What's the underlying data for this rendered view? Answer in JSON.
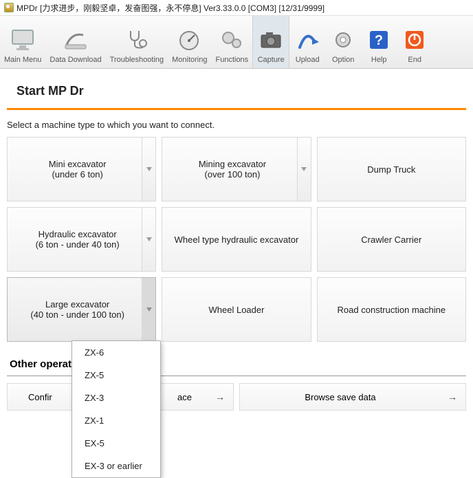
{
  "title": "MPDr [力求进步，刚毅坚卓，发奋图强，永不停息] Ver3.33.0.0 [COM3] [12/31/9999]",
  "toolbar": {
    "main": "Main Menu",
    "download": "Data Download",
    "trouble": "Troubleshooting",
    "monitor": "Monitoring",
    "functions": "Functions",
    "capture": "Capture",
    "upload": "Upload",
    "option": "Option",
    "help": "Help",
    "end": "End"
  },
  "page": {
    "heading": "Start MP Dr",
    "instruction": "Select a machine type to which you want to connect."
  },
  "machines": {
    "r1c1a": "Mini excavator",
    "r1c1b": "(under 6 ton)",
    "r1c2a": "Mining excavator",
    "r1c2b": "(over 100 ton)",
    "r1c3": "Dump Truck",
    "r2c1a": "Hydraulic excavator",
    "r2c1b": "(6 ton - under 40 ton)",
    "r2c2": "Wheel type hydraulic excavator",
    "r2c3": "Crawler Carrier",
    "r3c1a": "Large excavator",
    "r3c1b": "(40 ton - under 100 ton)",
    "r3c2": "Wheel Loader",
    "r3c3": "Road construction machine"
  },
  "dropdown": {
    "i0": "ZX-6",
    "i1": "ZX-5",
    "i2": "ZX-3",
    "i3": "ZX-1",
    "i4": "EX-5",
    "i5": "EX-3 or earlier"
  },
  "ops": {
    "section": "Other operations",
    "confirm_partial": "Confir",
    "ace_partial": "ace",
    "browse": "Browse save data"
  }
}
